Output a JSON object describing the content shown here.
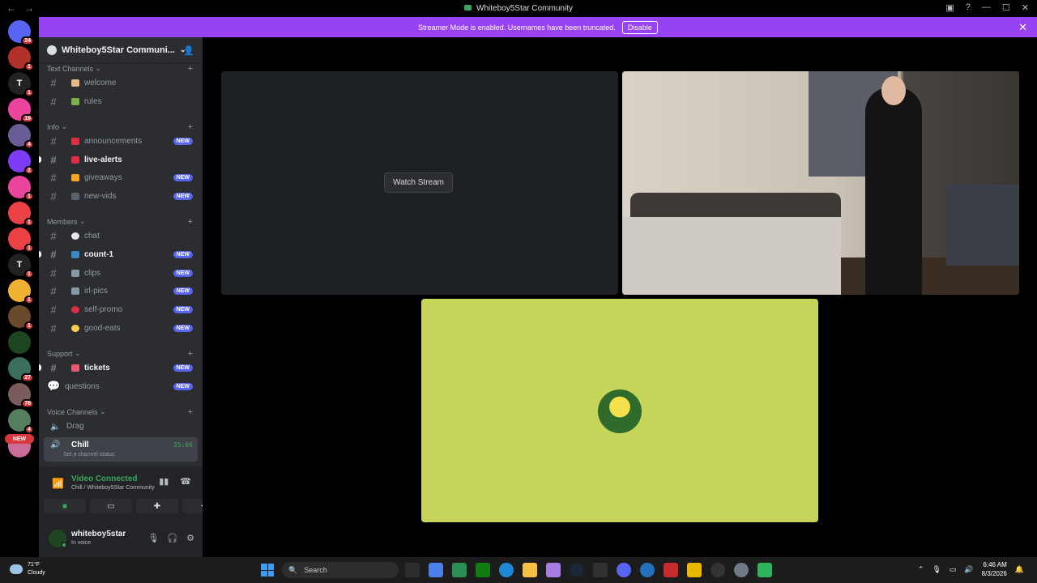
{
  "window": {
    "title": "Whiteboy5Star Community"
  },
  "banner": {
    "text": "Streamer Mode is enabled. Usernames have been truncated.",
    "button": "Disable"
  },
  "servers": [
    {
      "badge": "24",
      "color": "#5865f2",
      "icon": "discord-home-icon"
    },
    {
      "badge": "1",
      "color": "#b0312a",
      "icon": "server-icon"
    },
    {
      "badge": "1",
      "color": "#222",
      "icon": "server-icon",
      "letter": "T"
    },
    {
      "badge": "16",
      "color": "#eb459e",
      "icon": "server-icon"
    },
    {
      "badge": "4",
      "color": "#6b5b95",
      "icon": "server-icon"
    },
    {
      "badge": "2",
      "color": "#7d3cf8",
      "icon": "server-icon"
    },
    {
      "badge": "1",
      "color": "#eb459e",
      "icon": "server-icon"
    },
    {
      "badge": "1",
      "color": "#ed4245",
      "icon": "server-icon"
    },
    {
      "badge": "1",
      "color": "#ed4245",
      "icon": "server-icon"
    },
    {
      "badge": "1",
      "color": "#222",
      "icon": "server-icon",
      "letter": "T"
    },
    {
      "badge": "1",
      "color": "#f0b232",
      "icon": "server-icon"
    },
    {
      "badge": "1",
      "color": "#6a4a2a",
      "icon": "server-icon"
    },
    {
      "badge": "",
      "color": "#1e4620",
      "icon": "server-icon"
    },
    {
      "badge": "27",
      "color": "#3c6e5c",
      "icon": "server-icon"
    },
    {
      "badge": "78",
      "color": "#7a5c5c",
      "icon": "server-icon"
    },
    {
      "badge": "4",
      "color": "#567d5e",
      "icon": "server-icon"
    },
    {
      "badge": "",
      "color": "#c96d9b",
      "icon": "server-icon"
    }
  ],
  "server_new_label": "NEW",
  "guild": {
    "name": "Whiteboy5Star Communi..."
  },
  "categories": {
    "text": "Text Channels",
    "info": "Info",
    "members": "Members",
    "support": "Support",
    "voice": "Voice Channels"
  },
  "channels": {
    "welcome": "welcome",
    "rules": "rules",
    "announcements": "announcements",
    "live_alerts": "live-alerts",
    "giveaways": "giveaways",
    "new_vids": "new-vids",
    "chat": "chat",
    "count": "count-1",
    "clips": "clips",
    "irl_pics": "irl-pics",
    "self_promo": "self-promo",
    "good_eats": "good-eats",
    "tickets": "tickets",
    "questions": "questions",
    "drag": "Drag",
    "chill": "Chill",
    "chill_time": "35:06",
    "chill_status": "Set a channel status"
  },
  "new_label": "NEW",
  "voice": {
    "title": "Video Connected",
    "sub": "Chill / Whiteboy5Star Community"
  },
  "user": {
    "name": "whiteboy5star",
    "status": "In voice"
  },
  "stage": {
    "watch": "Watch Stream"
  },
  "taskbar": {
    "temp": "71°F",
    "weather": "Cloudy",
    "search": "Search",
    "time": "6:46 AM",
    "date": "8/3/2026"
  }
}
